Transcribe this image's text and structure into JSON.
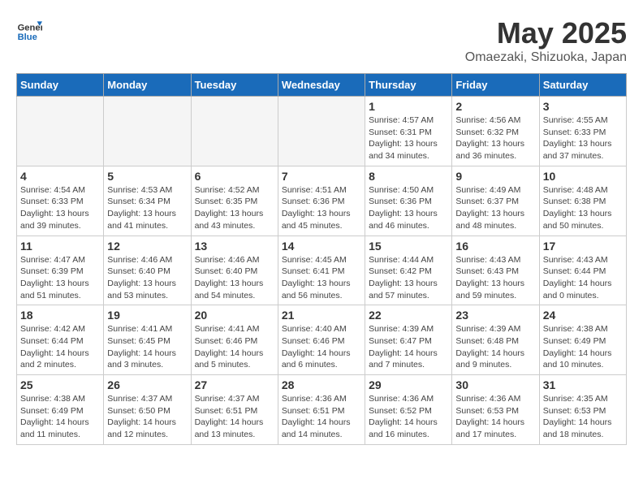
{
  "logo": {
    "general": "General",
    "blue": "Blue"
  },
  "title": "May 2025",
  "subtitle": "Omaezaki, Shizuoka, Japan",
  "days_of_week": [
    "Sunday",
    "Monday",
    "Tuesday",
    "Wednesday",
    "Thursday",
    "Friday",
    "Saturday"
  ],
  "weeks": [
    [
      {
        "day": "",
        "info": ""
      },
      {
        "day": "",
        "info": ""
      },
      {
        "day": "",
        "info": ""
      },
      {
        "day": "",
        "info": ""
      },
      {
        "day": "1",
        "info": "Sunrise: 4:57 AM\nSunset: 6:31 PM\nDaylight: 13 hours\nand 34 minutes."
      },
      {
        "day": "2",
        "info": "Sunrise: 4:56 AM\nSunset: 6:32 PM\nDaylight: 13 hours\nand 36 minutes."
      },
      {
        "day": "3",
        "info": "Sunrise: 4:55 AM\nSunset: 6:33 PM\nDaylight: 13 hours\nand 37 minutes."
      }
    ],
    [
      {
        "day": "4",
        "info": "Sunrise: 4:54 AM\nSunset: 6:33 PM\nDaylight: 13 hours\nand 39 minutes."
      },
      {
        "day": "5",
        "info": "Sunrise: 4:53 AM\nSunset: 6:34 PM\nDaylight: 13 hours\nand 41 minutes."
      },
      {
        "day": "6",
        "info": "Sunrise: 4:52 AM\nSunset: 6:35 PM\nDaylight: 13 hours\nand 43 minutes."
      },
      {
        "day": "7",
        "info": "Sunrise: 4:51 AM\nSunset: 6:36 PM\nDaylight: 13 hours\nand 45 minutes."
      },
      {
        "day": "8",
        "info": "Sunrise: 4:50 AM\nSunset: 6:36 PM\nDaylight: 13 hours\nand 46 minutes."
      },
      {
        "day": "9",
        "info": "Sunrise: 4:49 AM\nSunset: 6:37 PM\nDaylight: 13 hours\nand 48 minutes."
      },
      {
        "day": "10",
        "info": "Sunrise: 4:48 AM\nSunset: 6:38 PM\nDaylight: 13 hours\nand 50 minutes."
      }
    ],
    [
      {
        "day": "11",
        "info": "Sunrise: 4:47 AM\nSunset: 6:39 PM\nDaylight: 13 hours\nand 51 minutes."
      },
      {
        "day": "12",
        "info": "Sunrise: 4:46 AM\nSunset: 6:40 PM\nDaylight: 13 hours\nand 53 minutes."
      },
      {
        "day": "13",
        "info": "Sunrise: 4:46 AM\nSunset: 6:40 PM\nDaylight: 13 hours\nand 54 minutes."
      },
      {
        "day": "14",
        "info": "Sunrise: 4:45 AM\nSunset: 6:41 PM\nDaylight: 13 hours\nand 56 minutes."
      },
      {
        "day": "15",
        "info": "Sunrise: 4:44 AM\nSunset: 6:42 PM\nDaylight: 13 hours\nand 57 minutes."
      },
      {
        "day": "16",
        "info": "Sunrise: 4:43 AM\nSunset: 6:43 PM\nDaylight: 13 hours\nand 59 minutes."
      },
      {
        "day": "17",
        "info": "Sunrise: 4:43 AM\nSunset: 6:44 PM\nDaylight: 14 hours\nand 0 minutes."
      }
    ],
    [
      {
        "day": "18",
        "info": "Sunrise: 4:42 AM\nSunset: 6:44 PM\nDaylight: 14 hours\nand 2 minutes."
      },
      {
        "day": "19",
        "info": "Sunrise: 4:41 AM\nSunset: 6:45 PM\nDaylight: 14 hours\nand 3 minutes."
      },
      {
        "day": "20",
        "info": "Sunrise: 4:41 AM\nSunset: 6:46 PM\nDaylight: 14 hours\nand 5 minutes."
      },
      {
        "day": "21",
        "info": "Sunrise: 4:40 AM\nSunset: 6:46 PM\nDaylight: 14 hours\nand 6 minutes."
      },
      {
        "day": "22",
        "info": "Sunrise: 4:39 AM\nSunset: 6:47 PM\nDaylight: 14 hours\nand 7 minutes."
      },
      {
        "day": "23",
        "info": "Sunrise: 4:39 AM\nSunset: 6:48 PM\nDaylight: 14 hours\nand 9 minutes."
      },
      {
        "day": "24",
        "info": "Sunrise: 4:38 AM\nSunset: 6:49 PM\nDaylight: 14 hours\nand 10 minutes."
      }
    ],
    [
      {
        "day": "25",
        "info": "Sunrise: 4:38 AM\nSunset: 6:49 PM\nDaylight: 14 hours\nand 11 minutes."
      },
      {
        "day": "26",
        "info": "Sunrise: 4:37 AM\nSunset: 6:50 PM\nDaylight: 14 hours\nand 12 minutes."
      },
      {
        "day": "27",
        "info": "Sunrise: 4:37 AM\nSunset: 6:51 PM\nDaylight: 14 hours\nand 13 minutes."
      },
      {
        "day": "28",
        "info": "Sunrise: 4:36 AM\nSunset: 6:51 PM\nDaylight: 14 hours\nand 14 minutes."
      },
      {
        "day": "29",
        "info": "Sunrise: 4:36 AM\nSunset: 6:52 PM\nDaylight: 14 hours\nand 16 minutes."
      },
      {
        "day": "30",
        "info": "Sunrise: 4:36 AM\nSunset: 6:53 PM\nDaylight: 14 hours\nand 17 minutes."
      },
      {
        "day": "31",
        "info": "Sunrise: 4:35 AM\nSunset: 6:53 PM\nDaylight: 14 hours\nand 18 minutes."
      }
    ]
  ]
}
